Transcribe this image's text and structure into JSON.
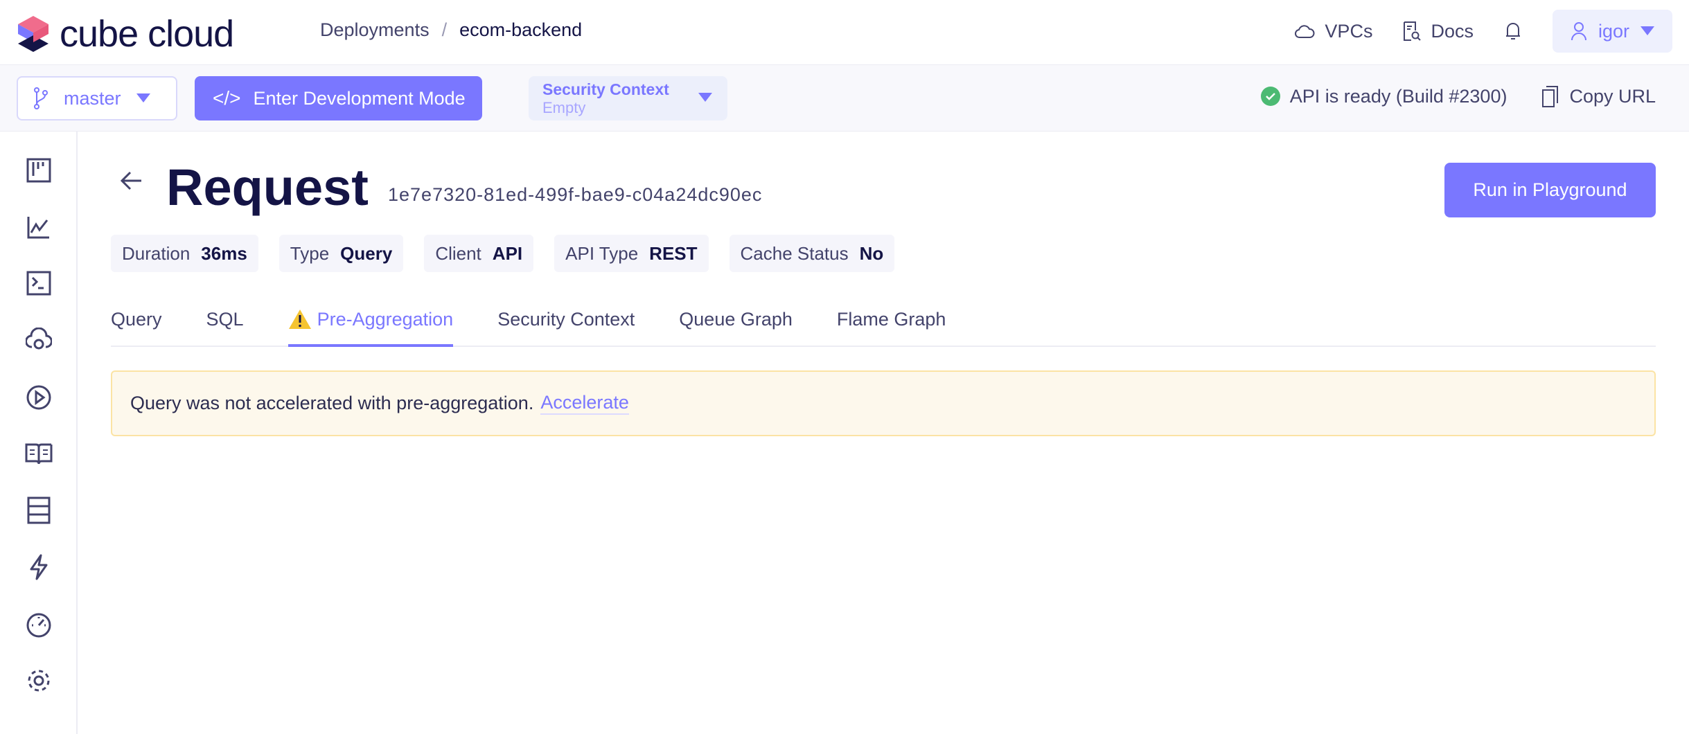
{
  "header": {
    "logo_text": "cube cloud",
    "breadcrumb": [
      "Deployments",
      "ecom-backend"
    ],
    "breadcrumb_sep": "/",
    "vpcs": "VPCs",
    "docs": "Docs",
    "user": "igor"
  },
  "toolbar": {
    "branch": "master",
    "dev_mode": "Enter Development Mode",
    "security_context_label": "Security Context",
    "security_context_value": "Empty",
    "api_status": "API is ready (Build #2300)",
    "copy_url": "Copy URL"
  },
  "sidebar": {
    "items": [
      "dashboard",
      "metrics",
      "sql-runner",
      "deploy",
      "playground",
      "schema",
      "data-model",
      "pre-aggregations",
      "performance",
      "settings"
    ]
  },
  "page": {
    "title": "Request",
    "request_id": "1e7e7320-81ed-499f-bae9-c04a24dc90ec",
    "run_button": "Run in Playground",
    "pills": [
      {
        "label": "Duration",
        "value": "36ms"
      },
      {
        "label": "Type",
        "value": "Query"
      },
      {
        "label": "Client",
        "value": "API"
      },
      {
        "label": "API Type",
        "value": "REST"
      },
      {
        "label": "Cache Status",
        "value": "No"
      }
    ],
    "tabs": [
      "Query",
      "SQL",
      "Pre-Aggregation",
      "Security Context",
      "Queue Graph",
      "Flame Graph"
    ],
    "active_tab": "Pre-Aggregation",
    "alert": {
      "text": "Query was not accelerated with pre-aggregation.",
      "link": "Accelerate"
    }
  },
  "colors": {
    "accent": "#7a77ff",
    "ok": "#4cba73",
    "warning": "#fbe3a4"
  }
}
